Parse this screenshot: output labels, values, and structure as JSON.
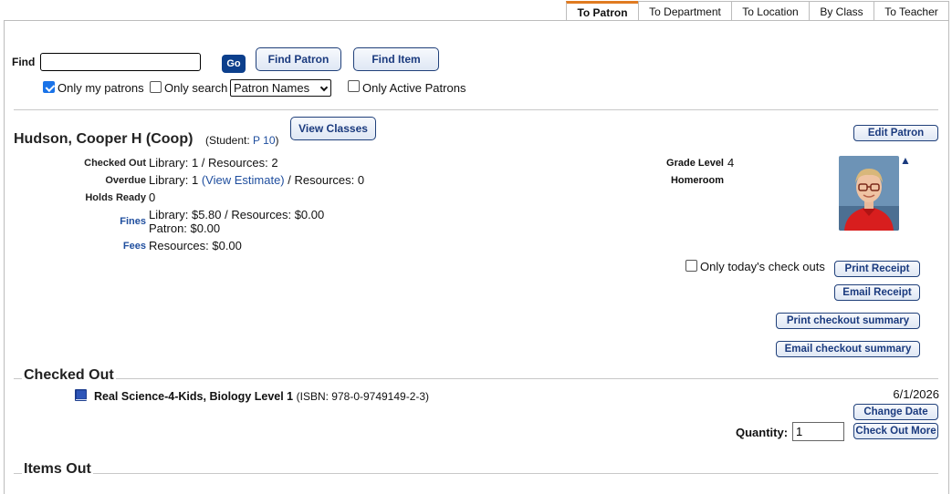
{
  "tabs": [
    {
      "label": "To Patron",
      "active": true
    },
    {
      "label": "To Department",
      "active": false
    },
    {
      "label": "To Location",
      "active": false
    },
    {
      "label": "By Class",
      "active": false
    },
    {
      "label": "To Teacher",
      "active": false
    }
  ],
  "find": {
    "label": "Find",
    "value": "",
    "go_label": "Go",
    "find_patron_label": "Find Patron",
    "find_item_label": "Find Item",
    "only_my_patrons_label": "Only my patrons",
    "only_my_patrons_checked": true,
    "only_search_label": "Only search",
    "only_search_checked": false,
    "search_field_selected": "Patron Names",
    "only_active_label": "Only Active Patrons",
    "only_active_checked": false
  },
  "patron": {
    "name": "Hudson, Cooper H (Coop)",
    "type_prefix": "(Student:",
    "barcode": "P 10",
    "type_suffix": ")",
    "view_classes_label": "View Classes",
    "edit_patron_label": "Edit Patron",
    "checked_out_label": "Checked Out",
    "checked_out_value": "Library: 1 / Resources: 2",
    "overdue_label": "Overdue",
    "overdue_prefix": "Library:",
    "overdue_library_count": "1",
    "overdue_estimate_link": "(View Estimate)",
    "overdue_suffix": "/ Resources: 0",
    "holds_label": "Holds Ready",
    "holds_value": "0",
    "fines_label": "Fines",
    "fines_line1": "Library: $5.80 / Resources: $0.00",
    "fines_line2": "Patron: $0.00",
    "fees_label": "Fees",
    "fees_value": "Resources: $0.00",
    "grade_label": "Grade Level",
    "grade_value": "4",
    "homeroom_label": "Homeroom",
    "homeroom_value": ""
  },
  "actions": {
    "only_today_label": "Only today's check outs",
    "only_today_checked": false,
    "print_receipt": "Print Receipt",
    "email_receipt": "Email Receipt",
    "print_summary": "Print checkout summary",
    "email_summary": "Email checkout summary"
  },
  "checked_out": {
    "title": "Checked Out",
    "items": [
      {
        "title": "Real Science-4-Kids, Biology Level 1",
        "isbn": "(ISBN: 978-0-9749149-2-3)",
        "due_date": "6/1/2026",
        "icon": "book-icon"
      }
    ],
    "change_date_label": "Change Date",
    "quantity_label": "Quantity:",
    "quantity_value": "1",
    "check_out_more_label": "Check Out More"
  },
  "items_out": {
    "title": "Items Out"
  },
  "colors": {
    "accent_tab": "#e07b21",
    "button_text": "#1a3a7e",
    "go_button": "#0c3f8c",
    "link": "#1f4e9e"
  }
}
